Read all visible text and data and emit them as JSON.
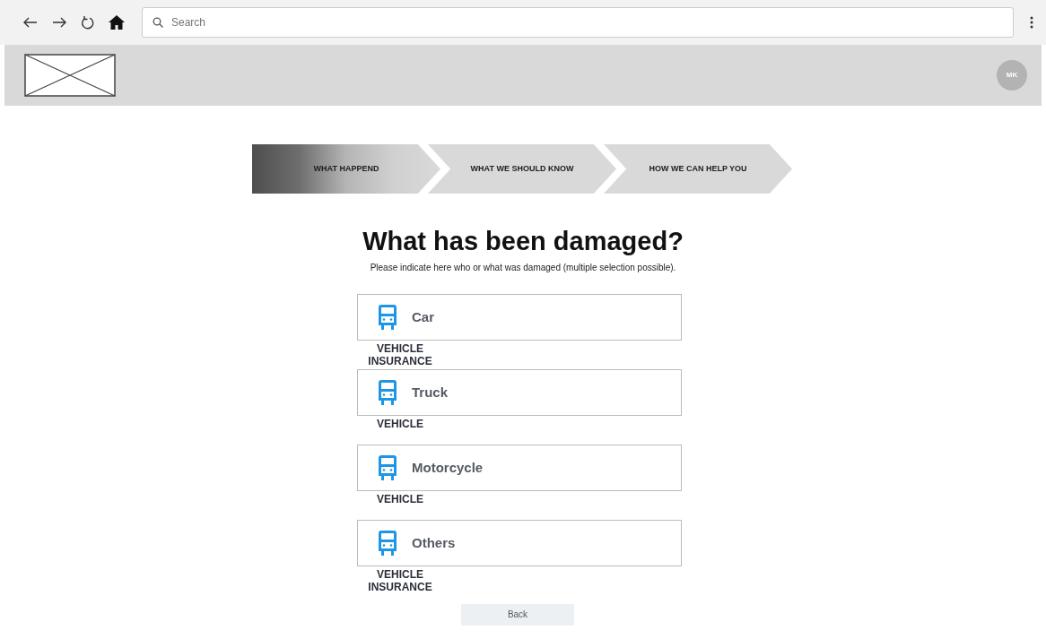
{
  "browser": {
    "search": {
      "placeholder": "Search"
    }
  },
  "header": {
    "avatar": "MK"
  },
  "steps": [
    {
      "label": "WHAT HAPPEND",
      "selected": true
    },
    {
      "label": "WHAT WE SHOULD KNOW",
      "selected": false
    },
    {
      "label": "HOW WE CAN HELP YOU",
      "selected": false
    }
  ],
  "title": "What has been damaged?",
  "subtitle": "Please indicate here who or what was damaged (multiple selection possible).",
  "options": [
    {
      "label": "Car",
      "caption": "VEHICLE INSURANCE"
    },
    {
      "label": "Truck",
      "caption": "VEHICLE"
    },
    {
      "label": "Motorcycle",
      "caption": "VEHICLE"
    },
    {
      "label": "Others",
      "caption": "VEHICLE INSURANCE"
    }
  ],
  "back_button": "Back"
}
